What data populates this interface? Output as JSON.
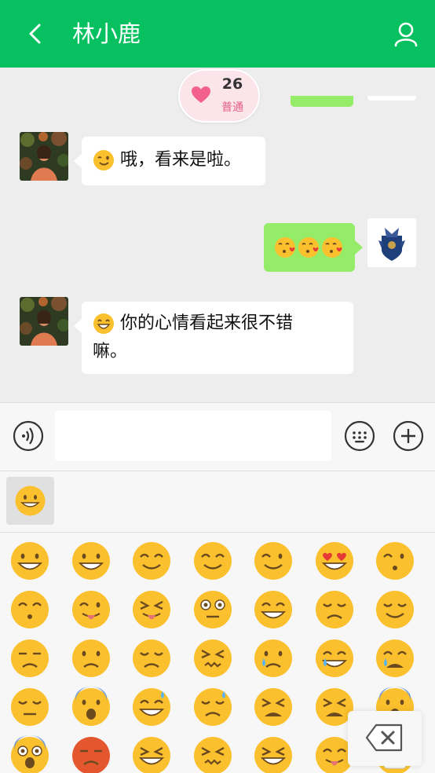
{
  "header": {
    "title": "林小鹿",
    "back_icon": "chevron-left-icon",
    "profile_icon": "user-icon",
    "background": "#07c160"
  },
  "intimacy": {
    "value": "26",
    "level": "普通",
    "icon": "heart-icon"
  },
  "messages": [
    {
      "side": "left",
      "text": "哦，看来是啦。",
      "emoji": "winking-face"
    },
    {
      "side": "right",
      "text": "",
      "emoji": [
        "kissing-heart-face",
        "kissing-heart-face",
        "kissing-heart-face"
      ]
    },
    {
      "side": "left",
      "text_line1": "你的心情看起来很不错",
      "text_line2": "嘛。",
      "emoji": "grinning-face-smiling-eyes"
    }
  ],
  "input": {
    "placeholder": "",
    "value": "",
    "voice_icon": "voice-icon",
    "emoji_icon": "emoji-keyboard-icon",
    "plus_icon": "plus-icon"
  },
  "emoji_panel": {
    "selected_tab": "smiley-face",
    "delete_icon": "backspace-icon",
    "emojis": [
      "smiley",
      "grinning",
      "blush",
      "relaxed",
      "wink",
      "heart-eyes",
      "kissing-heart",
      "kissing-closed-eyes",
      "stuck-out-tongue-winking",
      "stuck-out-tongue-closed-eyes",
      "flushed",
      "grin",
      "pensive",
      "relieved",
      "unamused",
      "worried",
      "disappointed",
      "confounded",
      "cry",
      "joy",
      "sob",
      "sleepy",
      "cold-sweat",
      "sweat-smile",
      "sweat",
      "tired-face",
      "weary",
      "fearful",
      "scream",
      "angry",
      "triumph",
      "persevere",
      "laughing",
      "yum",
      "mask"
    ]
  },
  "colors": {
    "accent_green": "#07c160",
    "bubble_green": "#95ec69",
    "background": "#ededed"
  }
}
